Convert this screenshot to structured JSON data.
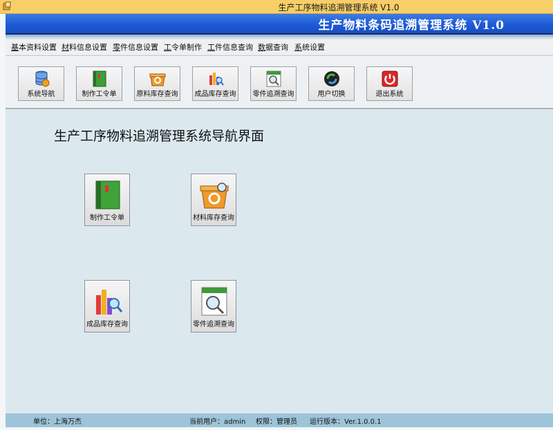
{
  "window": {
    "title": "生产工序物料追溯管理系统 V1.0"
  },
  "banner": {
    "title": "生产物料条码追溯管理系统 V1.0"
  },
  "menu": [
    {
      "label": "基本资料设置"
    },
    {
      "label": "材料信息设置"
    },
    {
      "label": "零件信息设置"
    },
    {
      "label": "工令单制作"
    },
    {
      "label": "工件信息查询"
    },
    {
      "label": "数据查询"
    },
    {
      "label": "系统设置"
    }
  ],
  "toolbar": [
    {
      "label": "系统导航",
      "icon": "database-icon"
    },
    {
      "label": "制作工令单",
      "icon": "book-icon"
    },
    {
      "label": "原料库存查询",
      "icon": "recycle-box-icon"
    },
    {
      "label": "成品库存查询",
      "icon": "chart-search-icon"
    },
    {
      "label": "零件追溯查询",
      "icon": "magnifier-doc-icon"
    },
    {
      "label": "用户切换",
      "icon": "sync-icon"
    },
    {
      "label": "退出系统",
      "icon": "power-icon"
    }
  ],
  "main": {
    "heading": "生产工序物料追溯管理系统导航界面",
    "tiles": [
      {
        "label": "制作工令单",
        "icon": "book-icon"
      },
      {
        "label": "材料库存查询",
        "icon": "recycle-box-icon"
      },
      {
        "label": "成品库存查询",
        "icon": "chart-search-icon"
      },
      {
        "label": "零件追溯查询",
        "icon": "magnifier-doc-icon"
      }
    ]
  },
  "status": {
    "unit": "单位：上海万杰",
    "user": "当前用户：admin",
    "role": "权限：管理员",
    "version": "运行版本：Ver.1.0.0.1"
  },
  "colors": {
    "banner": "#1d5ad8",
    "titlebar": "#f7ce67",
    "statusbar": "#9dc4d8",
    "background": "#dbe9ef"
  }
}
